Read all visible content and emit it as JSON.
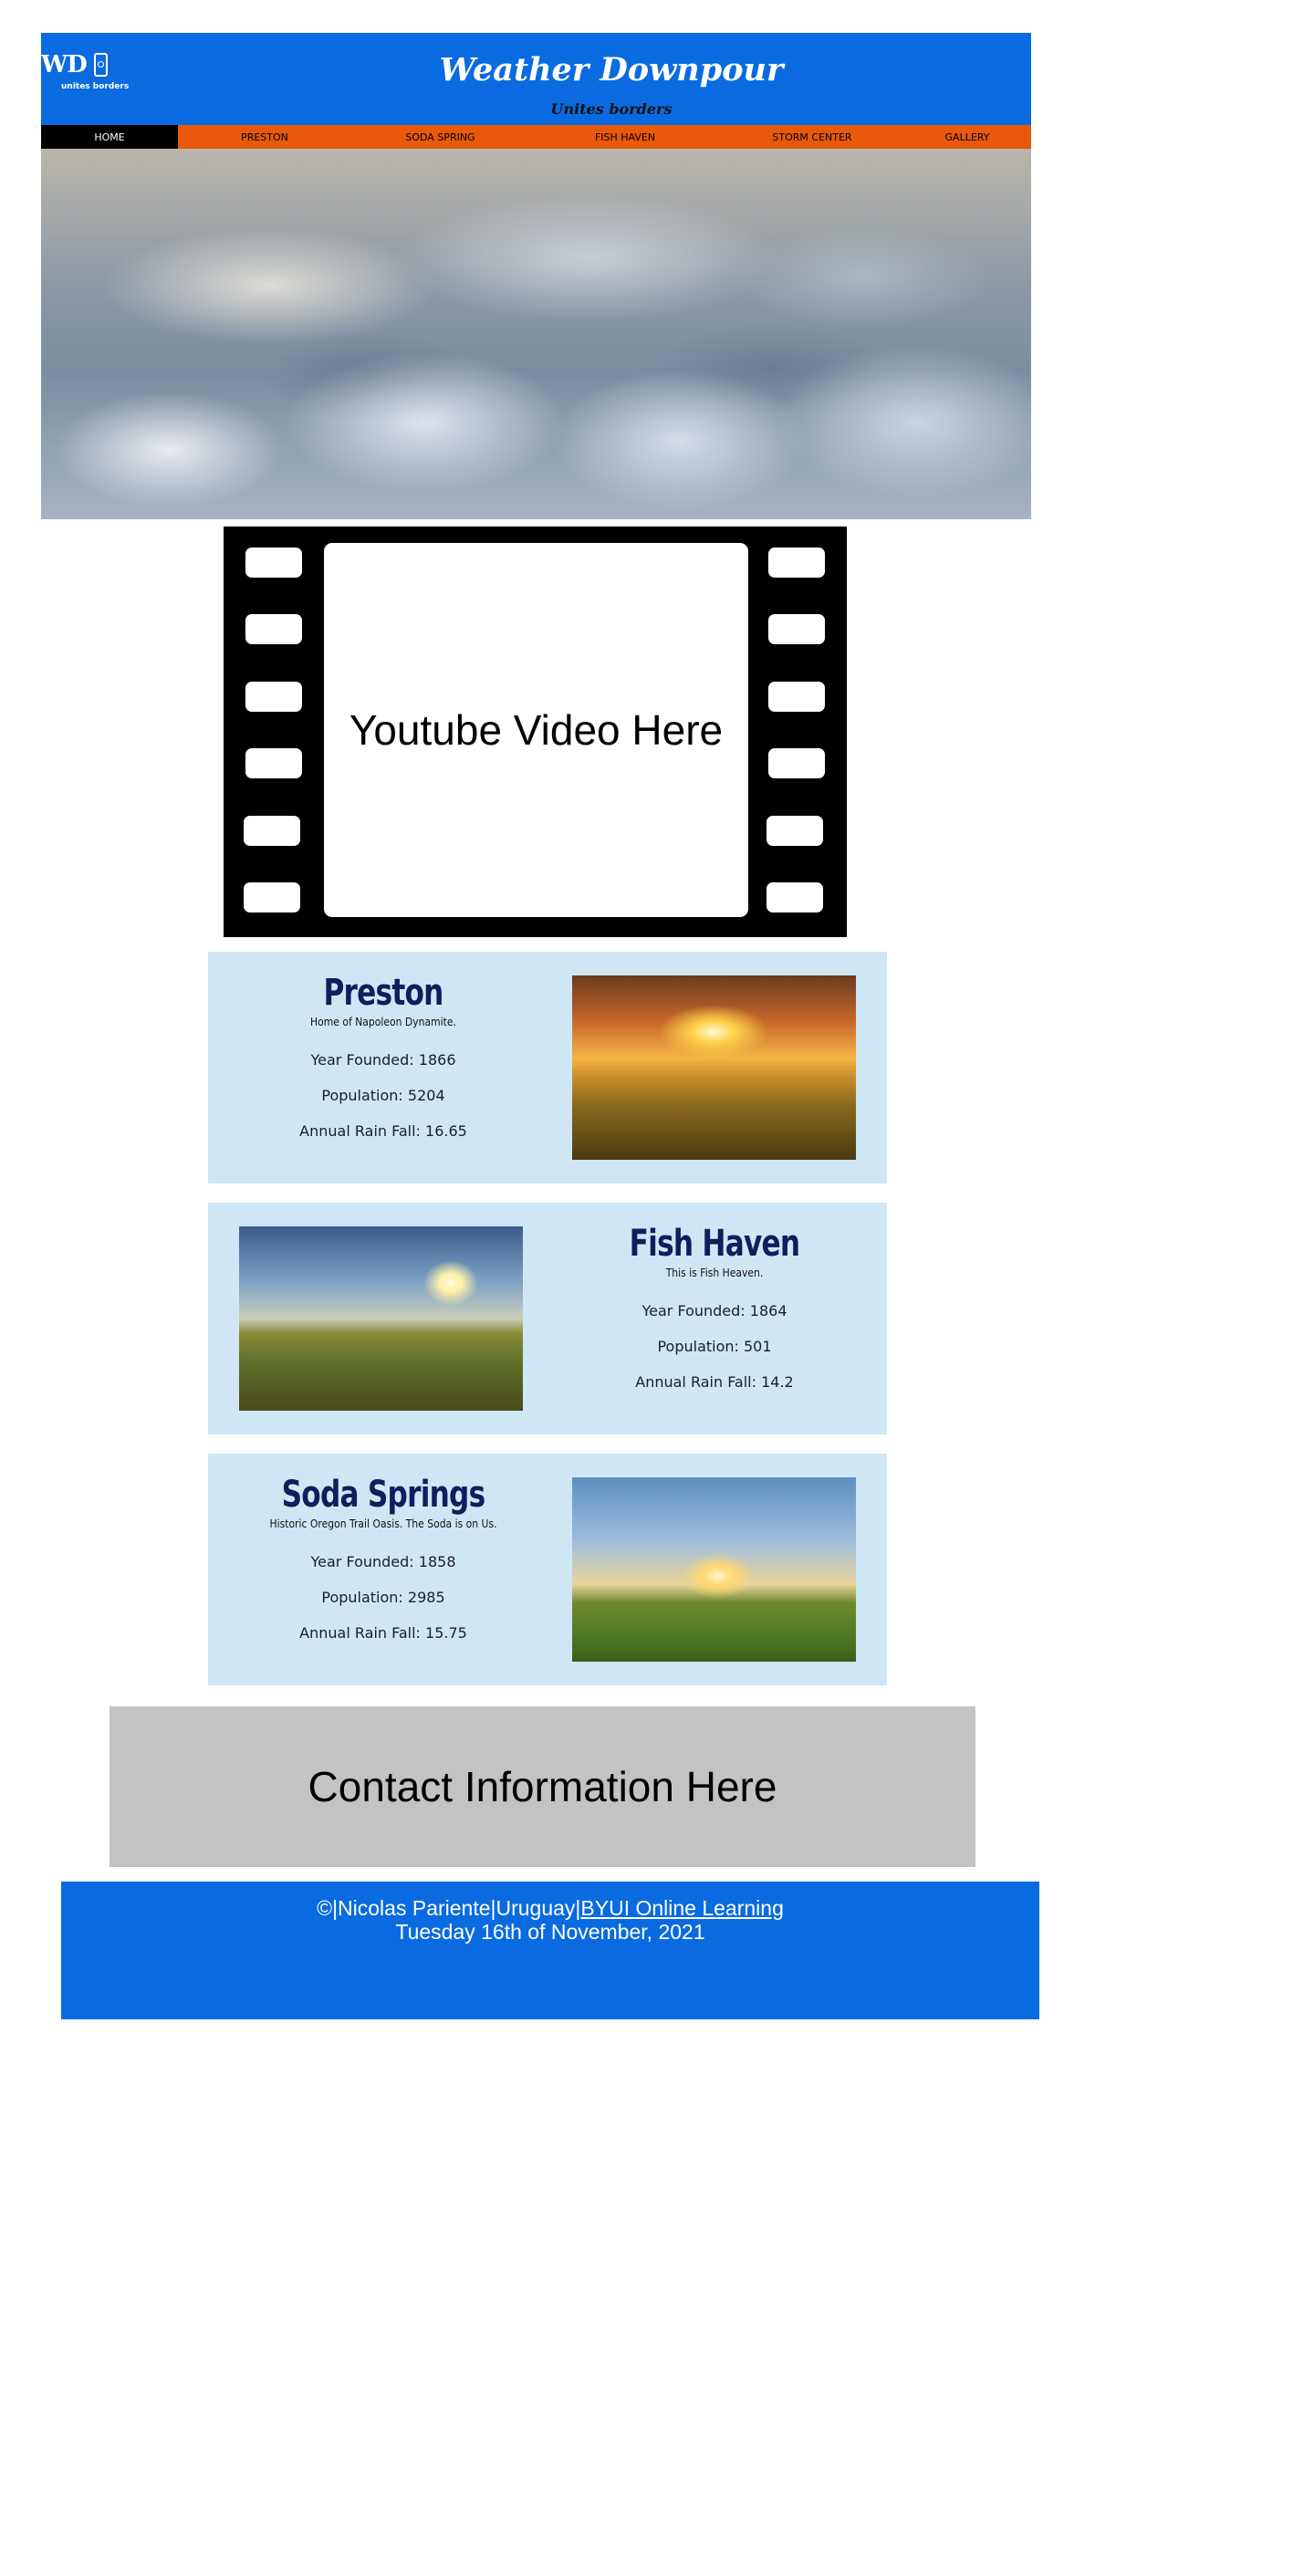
{
  "header": {
    "logo_text": "WD",
    "logo_tagline": "unites borders",
    "title": "Weather Downpour",
    "subtitle": "Unites borders",
    "brand_color": "#0a6be0"
  },
  "nav": {
    "items": [
      "HOME",
      "PRESTON",
      "SODA SPRING",
      "FISH HAVEN",
      "STORM CENTER",
      "GALLERY"
    ],
    "active": "HOME",
    "color": "#e8590c"
  },
  "video": {
    "label": "Youtube Video Here"
  },
  "towns": [
    {
      "name": "Preston",
      "motto": "Home of Napoleon Dynamite.",
      "year_founded": "Year Founded: 1866",
      "population": "Population: 5204",
      "rainfall": "Annual Rain Fall: 16.65"
    },
    {
      "name": "Fish Haven",
      "motto": "This is Fish Heaven.",
      "year_founded": "Year Founded: 1864",
      "population": "Population: 501",
      "rainfall": "Annual Rain Fall: 14.2"
    },
    {
      "name": "Soda Springs",
      "motto": "Historic Oregon Trail Oasis. The Soda is on Us.",
      "year_founded": "Year Founded: 1858",
      "population": "Population: 2985",
      "rainfall": "Annual Rain Fall: 15.75"
    }
  ],
  "contact": {
    "label": "Contact Information Here"
  },
  "footer": {
    "copyright": "©|Nicolas Pariente|Uruguay|",
    "link_label": "BYUI Online Learning",
    "date": "Tuesday 16th of November, 2021"
  }
}
